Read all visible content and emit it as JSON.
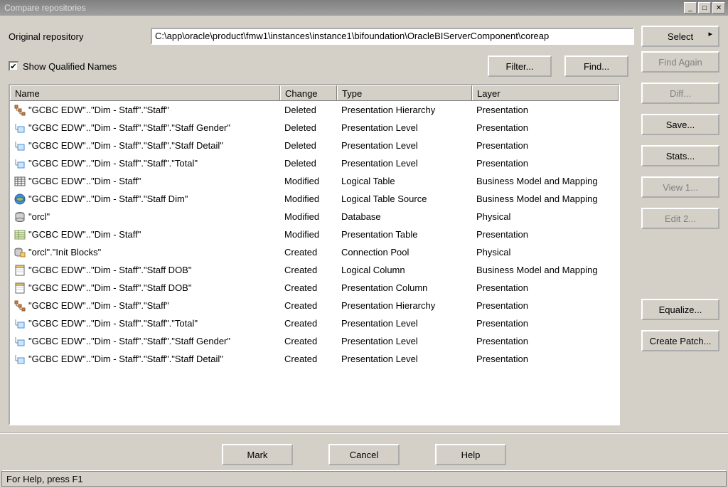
{
  "window": {
    "title": "Compare repositories"
  },
  "labels": {
    "original_repository": "Original repository",
    "show_qualified": "Show Qualified Names",
    "status": "For Help, press F1"
  },
  "path": "C:\\app\\oracle\\product\\fmw1\\instances\\instance1\\bifoundation\\OracleBIServerComponent\\coreap",
  "buttons": {
    "select": "Select",
    "filter": "Filter...",
    "find": "Find...",
    "find_again": "Find Again",
    "diff": "Diff...",
    "save": "Save...",
    "stats": "Stats...",
    "view1": "View 1...",
    "edit2": "Edit 2...",
    "equalize": "Equalize...",
    "create_patch": "Create Patch...",
    "mark": "Mark",
    "cancel": "Cancel",
    "help": "Help"
  },
  "columns": {
    "name": "Name",
    "change": "Change",
    "type": "Type",
    "layer": "Layer"
  },
  "rows": [
    {
      "icon": "hierarchy",
      "name": "\"GCBC EDW\"..\"Dim - Staff\".\"Staff\"",
      "change": "Deleted",
      "type": "Presentation Hierarchy",
      "layer": "Presentation"
    },
    {
      "icon": "level",
      "name": "\"GCBC EDW\"..\"Dim - Staff\".\"Staff\".\"Staff Gender\"",
      "change": "Deleted",
      "type": "Presentation Level",
      "layer": "Presentation"
    },
    {
      "icon": "level",
      "name": "\"GCBC EDW\"..\"Dim - Staff\".\"Staff\".\"Staff Detail\"",
      "change": "Deleted",
      "type": "Presentation Level",
      "layer": "Presentation"
    },
    {
      "icon": "level",
      "name": "\"GCBC EDW\"..\"Dim - Staff\".\"Staff\".\"Total\"",
      "change": "Deleted",
      "type": "Presentation Level",
      "layer": "Presentation"
    },
    {
      "icon": "table",
      "name": "\"GCBC EDW\"..\"Dim - Staff\"",
      "change": "Modified",
      "type": "Logical Table",
      "layer": "Business Model and Mapping"
    },
    {
      "icon": "source",
      "name": "\"GCBC EDW\"..\"Dim - Staff\".\"Staff Dim\"",
      "change": "Modified",
      "type": "Logical Table Source",
      "layer": "Business Model and Mapping"
    },
    {
      "icon": "database",
      "name": "\"orcl\"",
      "change": "Modified",
      "type": "Database",
      "layer": "Physical"
    },
    {
      "icon": "ptable",
      "name": "\"GCBC EDW\"..\"Dim - Staff\"",
      "change": "Modified",
      "type": "Presentation Table",
      "layer": "Presentation"
    },
    {
      "icon": "pool",
      "name": "\"orcl\".\"Init Blocks\"",
      "change": "Created",
      "type": "Connection Pool",
      "layer": "Physical"
    },
    {
      "icon": "column",
      "name": "\"GCBC EDW\"..\"Dim - Staff\".\"Staff DOB\"",
      "change": "Created",
      "type": "Logical Column",
      "layer": "Business Model and Mapping"
    },
    {
      "icon": "column",
      "name": "\"GCBC EDW\"..\"Dim - Staff\".\"Staff DOB\"",
      "change": "Created",
      "type": "Presentation Column",
      "layer": "Presentation"
    },
    {
      "icon": "hierarchy",
      "name": "\"GCBC EDW\"..\"Dim - Staff\".\"Staff\"",
      "change": "Created",
      "type": "Presentation Hierarchy",
      "layer": "Presentation"
    },
    {
      "icon": "level",
      "name": "\"GCBC EDW\"..\"Dim - Staff\".\"Staff\".\"Total\"",
      "change": "Created",
      "type": "Presentation Level",
      "layer": "Presentation"
    },
    {
      "icon": "level",
      "name": "\"GCBC EDW\"..\"Dim - Staff\".\"Staff\".\"Staff Gender\"",
      "change": "Created",
      "type": "Presentation Level",
      "layer": "Presentation"
    },
    {
      "icon": "level",
      "name": "\"GCBC EDW\"..\"Dim - Staff\".\"Staff\".\"Staff Detail\"",
      "change": "Created",
      "type": "Presentation Level",
      "layer": "Presentation"
    }
  ]
}
